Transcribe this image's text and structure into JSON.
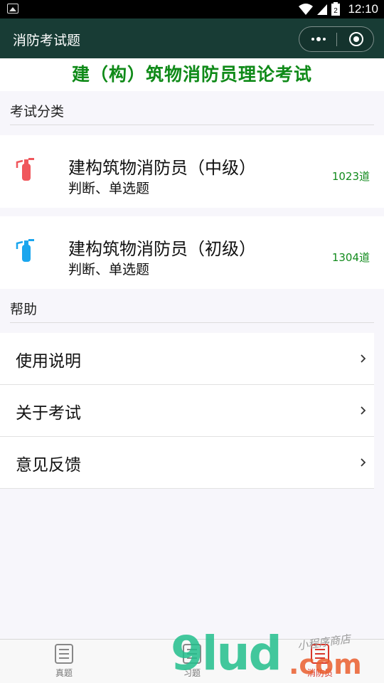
{
  "status_bar": {
    "time": "12:10",
    "battery_level": "2"
  },
  "navbar": {
    "title": "消防考试题"
  },
  "exam_title": "建（构）筑物消防员理论考试",
  "category_section": {
    "label": "考试分类"
  },
  "exams": [
    {
      "name": "建构筑物消防员（中级）",
      "type": "判断、单选题",
      "count": "1023道",
      "icon": "fire-extinguisher-icon",
      "color": "#f0575c"
    },
    {
      "name": "建构筑物消防员（初级）",
      "type": "判断、单选题",
      "count": "1304道",
      "icon": "fire-extinguisher-icon",
      "color": "#1aa6ee"
    }
  ],
  "help_section": {
    "label": "帮助",
    "items": [
      {
        "label": "使用说明"
      },
      {
        "label": "关于考试"
      },
      {
        "label": "意见反馈"
      }
    ]
  },
  "tabbar": {
    "tabs": [
      {
        "label": "真题",
        "icon": "list-icon",
        "active": false
      },
      {
        "label": "习题",
        "icon": "list-icon",
        "active": false
      },
      {
        "label": "消防员",
        "icon": "list-icon",
        "active": true
      }
    ]
  },
  "watermark": {
    "main": "9lud",
    "suffix": ".com",
    "sub": "小程序商店"
  }
}
